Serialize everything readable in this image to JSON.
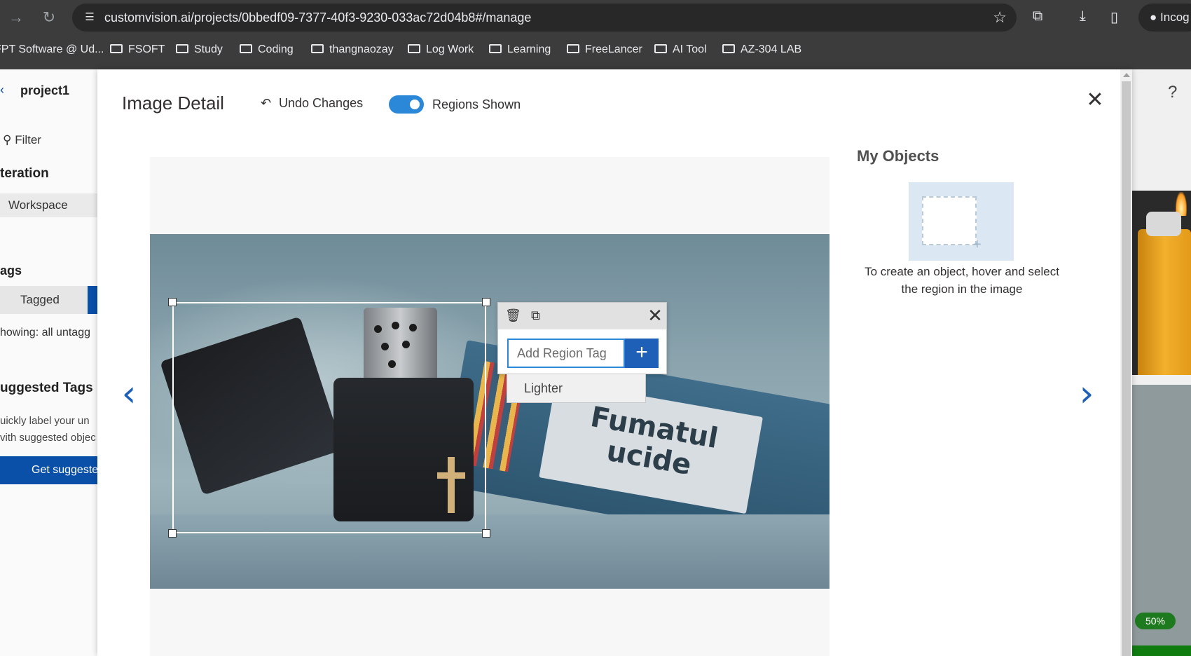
{
  "browser": {
    "url": "customvision.ai/projects/0bbedf09-7377-40f3-9230-033ac72d04b8#/manage",
    "incognito_label": "Incog",
    "bookmarks": [
      "FPT Software @ Ud...",
      "FSOFT",
      "Study",
      "Coding",
      "thangnaozay",
      "Log Work",
      "Learning",
      "FreeLancer",
      "AI Tool",
      "AZ-304 LAB"
    ]
  },
  "background_page": {
    "project_name": "project1",
    "filter_label": "Filter",
    "iteration_heading": "teration",
    "workspace_label": "Workspace",
    "tags_heading": "ags",
    "tagged_label": "Tagged",
    "showing_text": "howing: all untagg",
    "suggested_heading": "uggested Tags",
    "suggested_text_1": "uickly label your un",
    "suggested_text_2": "vith suggested objec",
    "get_suggested_label": "Get suggeste",
    "help_label": "?",
    "zoom_badge": "50%"
  },
  "modal": {
    "title": "Image Detail",
    "undo_label": "Undo Changes",
    "regions_toggle_label": "Regions Shown",
    "regions_toggle_on": true,
    "image_text_line1": "Fumatul",
    "image_text_line2": "ucide",
    "region_popup": {
      "tag_input_placeholder": "Add Region Tag",
      "tag_input_value": "",
      "add_button_label": "+",
      "suggestion": "Lighter"
    },
    "my_objects": {
      "heading": "My Objects",
      "hint": "To create an object, hover and select the region in the image"
    }
  },
  "colors": {
    "accent": "#2b88d8",
    "primary_button": "#1e5fb8",
    "nav_arrow": "#1e5fb8"
  }
}
